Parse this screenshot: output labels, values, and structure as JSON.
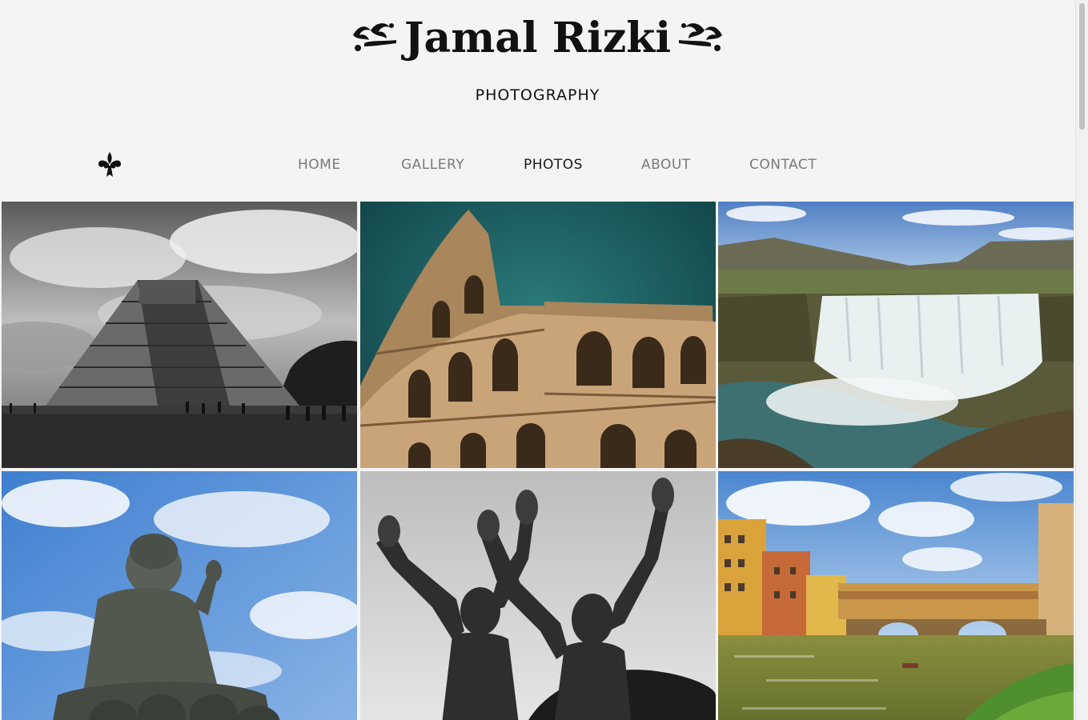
{
  "site": {
    "title": "Jamal Rizki",
    "tagline": "PHOTOGRAPHY",
    "nav_icon": "fleur-de-lis-icon"
  },
  "nav": {
    "items": [
      {
        "label": "HOME",
        "active": false
      },
      {
        "label": "GALLERY",
        "active": false
      },
      {
        "label": "PHOTOS",
        "active": true
      },
      {
        "label": "ABOUT",
        "active": false
      },
      {
        "label": "CONTACT",
        "active": false
      }
    ]
  },
  "gallery": {
    "photos": [
      {
        "subject": "stepped pyramid",
        "style": "black-and-white"
      },
      {
        "subject": "colosseum",
        "style": "color"
      },
      {
        "subject": "waterfall",
        "style": "color"
      },
      {
        "subject": "buddha statue",
        "style": "color"
      },
      {
        "subject": "statue with raised arms",
        "style": "black-and-white"
      },
      {
        "subject": "bridge over river",
        "style": "color"
      }
    ]
  },
  "colors": {
    "background": "#f4f4f4",
    "nav_inactive": "#7a7a7a",
    "nav_active": "#1a1a1a"
  }
}
